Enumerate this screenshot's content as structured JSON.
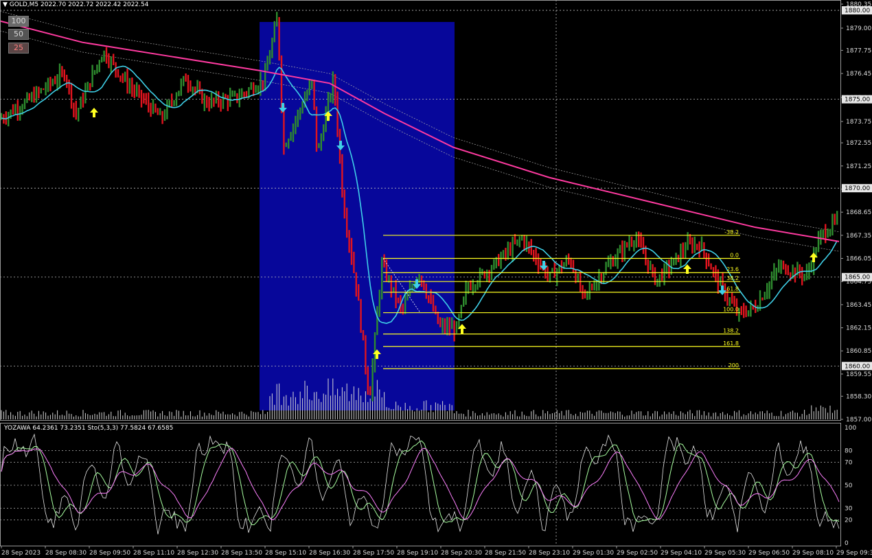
{
  "header": {
    "symbol_line": "GOLD,M5  2022.70 2022.72 2022.42 2022.54",
    "subwindow_line": "YOZAWA 64.2361 73.2351  Sto(5,3,3) 77.5824 67.6585"
  },
  "buttons": [
    "100",
    "50",
    "25"
  ],
  "price_axis": {
    "labels": [
      "1880.35",
      "1879.00",
      "1877.75",
      "1876.45",
      "1875.10",
      "1873.75",
      "1872.55",
      "1871.25",
      "1869.95",
      "1868.65",
      "1867.35",
      "1866.05",
      "1864.75",
      "1863.45",
      "1862.15",
      "1860.85",
      "1859.55",
      "1858.30",
      "1857.00"
    ],
    "highlighted": [
      "1880.00",
      "1875.00",
      "1870.00",
      "1865.00",
      "1860.00"
    ],
    "range": [
      1857.0,
      1880.35
    ]
  },
  "osc_axis": {
    "labels": [
      "100",
      "80",
      "70",
      "50",
      "30",
      "20",
      "0"
    ]
  },
  "time_axis": {
    "labels": [
      "28 Sep 2023",
      "28 Sep 08:30",
      "28 Sep 09:50",
      "28 Sep 11:10",
      "28 Sep 12:30",
      "28 Sep 13:50",
      "28 Sep 15:10",
      "28 Sep 16:30",
      "28 Sep 17:50",
      "28 Sep 19:10",
      "28 Sep 20:30",
      "28 Sep 21:50",
      "28 Sep 23:10",
      "29 Sep 01:30",
      "29 Sep 02:50",
      "29 Sep 04:10",
      "29 Sep 05:30",
      "29 Sep 06:50",
      "29 Sep 08:10",
      "29 Sep 09:30"
    ]
  },
  "fibonacci": {
    "levels": [
      {
        "label": "-38.2",
        "price": 1867.35
      },
      {
        "label": "0.0",
        "price": 1866.05
      },
      {
        "label": "23.6",
        "price": 1865.25
      },
      {
        "label": "38.2",
        "price": 1864.75
      },
      {
        "label": "61.8",
        "price": 1864.15
      },
      {
        "label": "100.0",
        "price": 1863.0
      },
      {
        "label": "138.2",
        "price": 1861.8
      },
      {
        "label": "161.8",
        "price": 1861.1
      },
      {
        "label": "200",
        "price": 1859.85
      }
    ]
  },
  "colors": {
    "bull": "#2e8b2e",
    "bear": "#e0141e",
    "ma_fast": "#3fd0e8",
    "ma_slow": "#ff3aa0",
    "fib": "#ffff20",
    "session_box": "#07079a",
    "grid": "#c0c0c0",
    "axis_hl": "#e0e0e0"
  },
  "icons": [
    "up-arrow-icon",
    "down-arrow-icon"
  ]
}
